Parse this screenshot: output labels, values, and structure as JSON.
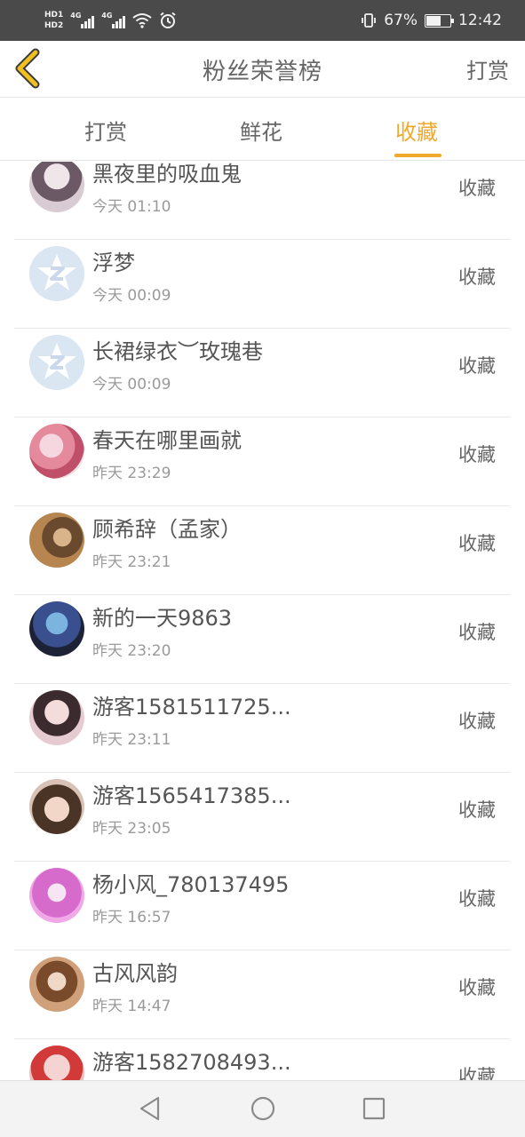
{
  "status_bar": {
    "hd1": "HD1",
    "hd2": "HD2",
    "net1": "4G",
    "net2": "4G",
    "battery_percent": "67%",
    "battery_level": 0.67,
    "time": "12:42",
    "icons": [
      "wifi-icon",
      "alarm-icon",
      "vibrate-icon",
      "battery-icon"
    ]
  },
  "header": {
    "title": "粉丝荣誉榜",
    "action": "打赏",
    "back_icon": "chevron-left-icon",
    "accent_color": "#f0c020"
  },
  "tabs": [
    {
      "label": "打赏",
      "active": false
    },
    {
      "label": "鲜花",
      "active": false
    },
    {
      "label": "收藏",
      "active": true
    }
  ],
  "accent_color": "#f0a92d",
  "list": [
    {
      "name": "黑夜里的吸血鬼",
      "time": "今天 01:10",
      "action": "收藏"
    },
    {
      "name": "浮梦",
      "time": "今天 00:09",
      "action": "收藏"
    },
    {
      "name": "长裙绿衣︶玫瑰巷",
      "time": "今天 00:09",
      "action": "收藏"
    },
    {
      "name": "春天在哪里画就",
      "time": "昨天 23:29",
      "action": "收藏"
    },
    {
      "name": "顾希辞（孟家）",
      "time": "昨天 23:21",
      "action": "收藏"
    },
    {
      "name": "新的一天9863",
      "time": "昨天 23:20",
      "action": "收藏"
    },
    {
      "name": "游客1581511725...",
      "time": "昨天 23:11",
      "action": "收藏"
    },
    {
      "name": "游客1565417385...",
      "time": "昨天 23:05",
      "action": "收藏"
    },
    {
      "name": "杨小风_780137495",
      "time": "昨天 16:57",
      "action": "收藏"
    },
    {
      "name": "古风风韵",
      "time": "昨天 14:47",
      "action": "收藏"
    },
    {
      "name": "游客1582708493...",
      "time": "",
      "action": "收藏"
    }
  ],
  "nav_bar": {
    "buttons": [
      "back-triangle-icon",
      "home-circle-icon",
      "recents-square-icon"
    ]
  }
}
